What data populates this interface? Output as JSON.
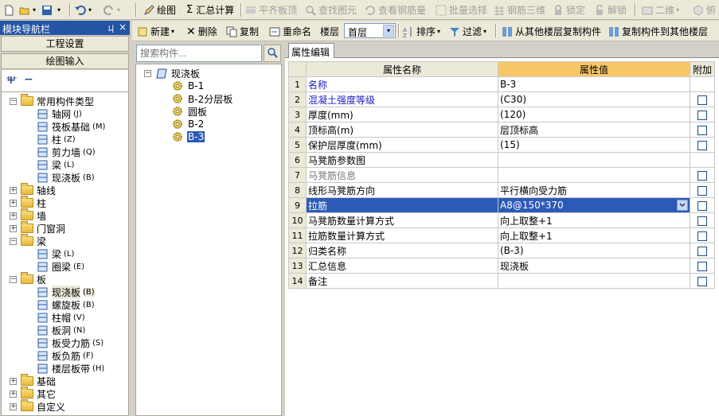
{
  "toolbar": {
    "draw": "绘图",
    "sum_calc": "汇总计算",
    "align_slab_top": "平齐板顶",
    "find_element": "查找图元",
    "view_rebar_qty": "查看钢筋量",
    "batch_select": "批量选择",
    "rebar_3d": "钢筋三维",
    "lock": "锁定",
    "unlock": "解锁",
    "view_2d": "二维",
    "view_more": "俯"
  },
  "nav": {
    "title": "模块导航栏",
    "pin": "ㄐ",
    "close": "×",
    "project_settings": "工程设置",
    "drawing_input": "绘图输入",
    "tree": [
      {
        "label": "常用构件类型",
        "kind": "folder",
        "expanded": true
      },
      {
        "label": "轴网",
        "suffix": "(J)",
        "icon": "grid-icon"
      },
      {
        "label": "筏板基础",
        "suffix": "(M)",
        "icon": "raft-icon"
      },
      {
        "label": "柱",
        "suffix": "(Z)",
        "icon": "column-icon"
      },
      {
        "label": "剪力墙",
        "suffix": "(Q)",
        "icon": "shear-wall-icon"
      },
      {
        "label": "梁",
        "suffix": "(L)",
        "icon": "beam-icon"
      },
      {
        "label": "现浇板",
        "suffix": "(B)",
        "icon": "slab-icon"
      },
      {
        "label": "轴线",
        "kind": "folder"
      },
      {
        "label": "柱",
        "kind": "folder"
      },
      {
        "label": "墙",
        "kind": "folder"
      },
      {
        "label": "门窗洞",
        "kind": "folder"
      },
      {
        "label": "梁",
        "kind": "folder",
        "expanded": true
      },
      {
        "label": "梁",
        "suffix": "(L)",
        "icon": "beam-icon"
      },
      {
        "label": "圈梁",
        "suffix": "(E)",
        "icon": "ring-beam-icon"
      },
      {
        "label": "板",
        "kind": "folder",
        "expanded": true
      },
      {
        "label": "现浇板",
        "suffix": "(B)",
        "icon": "slab-icon",
        "selected": true
      },
      {
        "label": "螺旋板",
        "suffix": "(B)",
        "icon": "spiral-slab-icon"
      },
      {
        "label": "柱帽",
        "suffix": "(V)",
        "icon": "column-cap-icon"
      },
      {
        "label": "板洞",
        "suffix": "(N)",
        "icon": "slab-hole-icon"
      },
      {
        "label": "板受力筋",
        "suffix": "(S)",
        "icon": "slab-rebar-icon"
      },
      {
        "label": "板负筋",
        "suffix": "(F)",
        "icon": "negative-rebar-icon"
      },
      {
        "label": "楼层板带",
        "suffix": "(H)",
        "icon": "slab-strip-icon"
      },
      {
        "label": "基础",
        "kind": "folder"
      },
      {
        "label": "其它",
        "kind": "folder"
      },
      {
        "label": "自定义",
        "kind": "folder"
      }
    ]
  },
  "comp_toolbar": {
    "new": "新建",
    "delete": "删除",
    "copy": "复制",
    "rename": "重命名",
    "floor_label": "楼层",
    "floor_value": "首层",
    "sort": "排序",
    "filter": "过滤",
    "copy_from_floor": "从其他楼层复制构件",
    "copy_to_floor": "复制构件到其他楼层"
  },
  "search": {
    "placeholder": "搜索构件..."
  },
  "components": {
    "root": "现浇板",
    "items": [
      "B-1",
      "B-2分层板",
      "圆板",
      "B-2",
      "B-3"
    ],
    "selected": "B-3"
  },
  "props": {
    "tab": "属性编辑",
    "headers": {
      "name": "属性名称",
      "value": "属性值",
      "extra": "附加"
    },
    "rows": [
      {
        "n": "1",
        "name": "名称",
        "value": "B-3",
        "style": "blue",
        "checkbox": false
      },
      {
        "n": "2",
        "name": "混凝土强度等级",
        "value": "(C30)",
        "style": "blue",
        "checkbox": true
      },
      {
        "n": "3",
        "name": "厚度(mm)",
        "value": "(120)",
        "style": "",
        "checkbox": true
      },
      {
        "n": "4",
        "name": "顶标高(m)",
        "value": "层顶标高",
        "style": "",
        "checkbox": true
      },
      {
        "n": "5",
        "name": "保护层厚度(mm)",
        "value": "(15)",
        "style": "",
        "checkbox": true
      },
      {
        "n": "6",
        "name": "马凳筋参数图",
        "value": "",
        "style": "",
        "checkbox": false
      },
      {
        "n": "7",
        "name": "马凳筋信息",
        "value": "",
        "style": "gray",
        "checkbox": true
      },
      {
        "n": "8",
        "name": "线形马凳筋方向",
        "value": "平行横向受力筋",
        "style": "",
        "checkbox": true
      },
      {
        "n": "9",
        "name": "拉筋",
        "value": "A8@150*370",
        "style": "",
        "checkbox": true,
        "selected": true
      },
      {
        "n": "10",
        "name": "马凳筋数量计算方式",
        "value": "向上取整+1",
        "style": "",
        "checkbox": true
      },
      {
        "n": "11",
        "name": "拉筋数量计算方式",
        "value": "向上取整+1",
        "style": "",
        "checkbox": true
      },
      {
        "n": "12",
        "name": "归类名称",
        "value": "(B-3)",
        "style": "",
        "checkbox": true
      },
      {
        "n": "13",
        "name": "汇总信息",
        "value": "现浇板",
        "style": "",
        "checkbox": true
      },
      {
        "n": "14",
        "name": "备注",
        "value": "",
        "style": "",
        "checkbox": true
      }
    ]
  },
  "colors": {
    "title_bar": "#2455a4",
    "selection": "#2c5ab8",
    "header_value": "#f8c868"
  }
}
